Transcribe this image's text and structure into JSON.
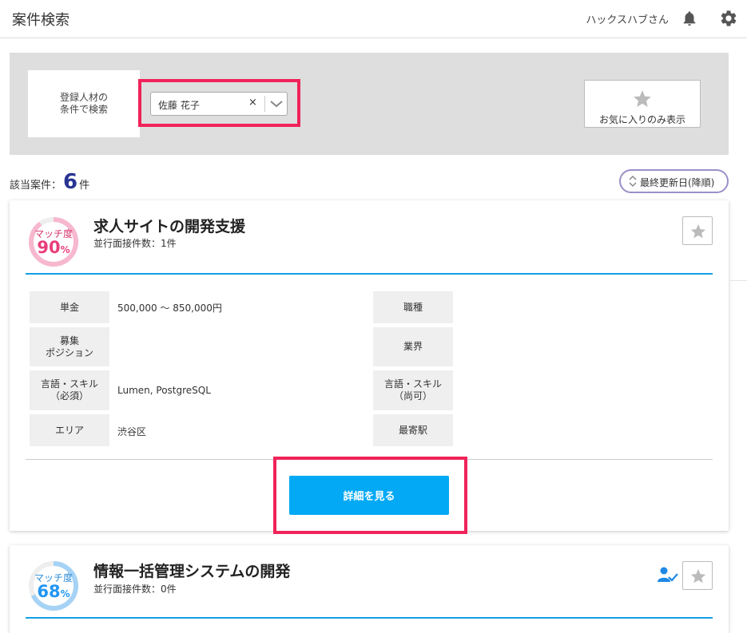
{
  "header": {
    "title": "案件検索",
    "user_name": "ハックスハブさん",
    "icons": [
      "bell-icon",
      "gear-icon"
    ]
  },
  "search": {
    "condition_label": "登録人材の\n条件で検索",
    "selected_person": "佐藤 花子",
    "clear_symbol": "×",
    "favorites_only_label": "お気に入りのみ表示"
  },
  "results": {
    "count_prefix": "該当案件：",
    "count": "6",
    "count_suffix": "件",
    "sort_label": "最終更新日(降順)"
  },
  "cards": [
    {
      "match_label": "マッチ度",
      "match_value": "90",
      "match_unit": "%",
      "match_fraction": 0.9,
      "title": "求人サイトの開発支援",
      "parallel_interviews": "並行面接件数：1件",
      "fields": {
        "price_label": "単金",
        "price_value": "500,000 ～ 850,000円",
        "job_type_label": "職種",
        "job_type_value": "",
        "position_label": "募集\nポジション",
        "position_value": "",
        "industry_label": "業界",
        "industry_value": "",
        "required_skills_label": "言語・スキル\n（必須）",
        "required_skills_value": "Lumen, PostgreSQL",
        "preferred_skills_label": "言語・スキル\n（尚可）",
        "preferred_skills_value": "",
        "area_label": "エリア",
        "area_value": "渋谷区",
        "station_label": "最寄駅",
        "station_value": ""
      },
      "detail_button": "詳細を見る",
      "colors": {
        "match": "#e83e7a",
        "ring": "#f7b8cf"
      }
    },
    {
      "match_label": "マッチ度",
      "match_value": "68",
      "match_unit": "%",
      "match_fraction": 0.68,
      "title": "情報一括管理システムの開発",
      "parallel_interviews": "並行面接件数：0件",
      "colors": {
        "match": "#2196f3",
        "ring": "#a6d3f5"
      }
    }
  ],
  "colors": {
    "accent_blue": "#03a9f4",
    "highlight_red": "#f0235a",
    "count_navy": "#283593"
  }
}
